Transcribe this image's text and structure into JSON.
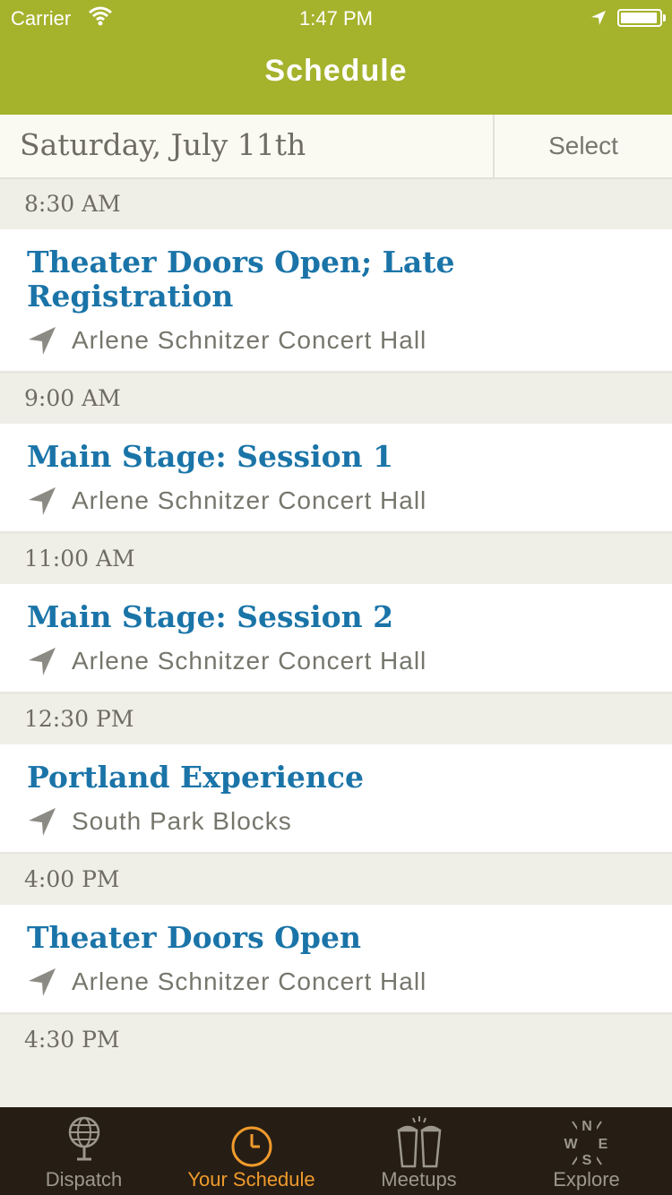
{
  "status_bar": {
    "carrier": "Carrier",
    "time": "1:47 PM",
    "battery_level": 0.95
  },
  "nav": {
    "title": "Schedule"
  },
  "date_bar": {
    "date": "Saturday, July 11th",
    "select_label": "Select"
  },
  "schedule": [
    {
      "time": "8:30 AM",
      "events": [
        {
          "title": "Theater Doors Open; Late Registration",
          "location": "Arlene Schnitzer Concert Hall"
        }
      ]
    },
    {
      "time": "9:00 AM",
      "events": [
        {
          "title": "Main Stage: Session 1",
          "location": "Arlene Schnitzer Concert Hall"
        }
      ]
    },
    {
      "time": "11:00 AM",
      "events": [
        {
          "title": "Main Stage: Session 2",
          "location": "Arlene Schnitzer Concert Hall"
        }
      ]
    },
    {
      "time": "12:30 PM",
      "events": [
        {
          "title": "Portland Experience",
          "location": "South Park Blocks"
        }
      ]
    },
    {
      "time": "4:00 PM",
      "events": [
        {
          "title": "Theater Doors Open",
          "location": "Arlene Schnitzer Concert Hall"
        }
      ]
    },
    {
      "time": "4:30 PM",
      "events": []
    }
  ],
  "tabs": [
    {
      "label": "Dispatch",
      "icon": "globe-icon",
      "active": false
    },
    {
      "label": "Your Schedule",
      "icon": "clock-icon",
      "active": true
    },
    {
      "label": "Meetups",
      "icon": "beer-glasses-icon",
      "active": false
    },
    {
      "label": "Explore",
      "icon": "compass-icon",
      "active": false
    }
  ],
  "colors": {
    "header": "#a5b22c",
    "event_title": "#1a74a8",
    "tab_bar": "#261e15",
    "tab_active": "#f09a2c"
  }
}
